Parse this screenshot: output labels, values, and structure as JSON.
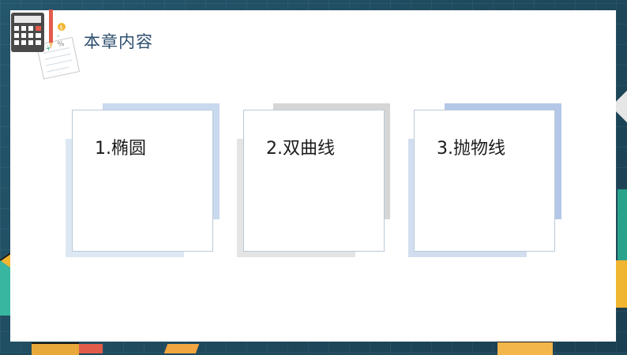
{
  "header": {
    "title": "本章内容",
    "icon": "calculator-notepad-icon"
  },
  "cards": [
    {
      "label": "1.椭圆",
      "accent": "#c9d9ee"
    },
    {
      "label": "2.双曲线",
      "accent": "#d9d9d9"
    },
    {
      "label": "3.抛物线",
      "accent": "#b4c7e7"
    }
  ],
  "colors": {
    "background": "#1f4a5e",
    "panel": "#ffffff",
    "title": "#2e4e6e",
    "card_border": "#b9c9d9"
  }
}
